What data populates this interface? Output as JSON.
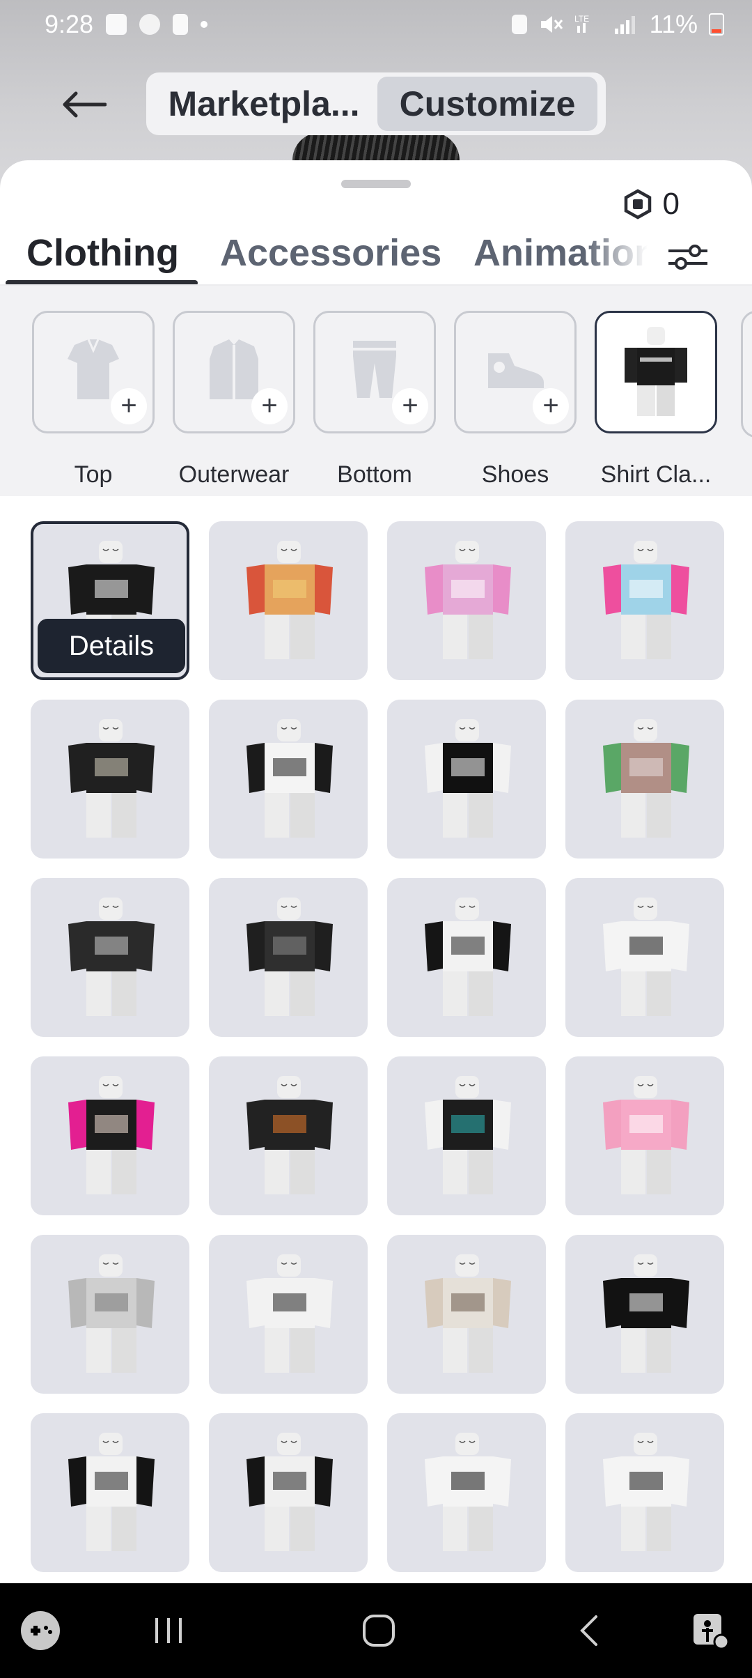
{
  "status_bar": {
    "time": "9:28",
    "battery": "11%"
  },
  "header": {
    "segments": [
      "Marketpla...",
      "Customize"
    ],
    "active_segment": "Customize"
  },
  "currency": {
    "amount": "0"
  },
  "tabs": [
    {
      "label": "Clothing",
      "active": true
    },
    {
      "label": "Accessories",
      "active": false
    },
    {
      "label": "Animation",
      "active": false
    }
  ],
  "slots": [
    {
      "label": "Top",
      "icon": "shirt-icon"
    },
    {
      "label": "Outerwear",
      "icon": "jacket-icon"
    },
    {
      "label": "Bottom",
      "icon": "pants-icon"
    },
    {
      "label": "Shoes",
      "icon": "shoe-icon"
    },
    {
      "label": "Shirt Cla...",
      "icon": "avatar-thumbnail"
    }
  ],
  "items": {
    "details_label": "Details",
    "list": [
      {
        "name": "black-shirt-selected",
        "torso": "#1a1a1a",
        "arms": "#1a1a1a",
        "accent": "#ffffff"
      },
      {
        "name": "red-yellow-shirt",
        "torso": "#e5a35c",
        "arms": "#d9553b",
        "accent": "#f2d27a"
      },
      {
        "name": "pink-purple-shirt",
        "torso": "#e5a9d6",
        "arms": "#e88dc8",
        "accent": "#ffffff"
      },
      {
        "name": "pink-anime-shirt",
        "torso": "#9fd3e8",
        "arms": "#ee4f9e",
        "accent": "#ffffff"
      },
      {
        "name": "skeleton-shirt",
        "torso": "#202020",
        "arms": "#202020",
        "accent": "#d7d2c0"
      },
      {
        "name": "maid-shirt",
        "torso": "#f4f4f4",
        "arms": "#1b1b1b",
        "accent": "#1b1b1b"
      },
      {
        "name": "ghost-shirt",
        "torso": "#111111",
        "arms": "#f2f2f2",
        "accent": "#ffffff"
      },
      {
        "name": "green-sleeve-shirt",
        "torso": "#b18f86",
        "arms": "#5aa766",
        "accent": "#e6dcdc"
      },
      {
        "name": "money-shirt",
        "torso": "#2a2a2a",
        "arms": "#2a2a2a",
        "accent": "#cccccc"
      },
      {
        "name": "black-vest-shirt",
        "torso": "#2f2f2f",
        "arms": "#1f1f1f",
        "accent": "#8a8a8a"
      },
      {
        "name": "raglan-shirt",
        "torso": "#f2f2f2",
        "arms": "#151515",
        "accent": "#222222"
      },
      {
        "name": "anime-face-shirt",
        "torso": "#f4f4f4",
        "arms": "#f4f4f4",
        "accent": "#111111"
      },
      {
        "name": "leopard-pink-shirt",
        "torso": "#1c1c1c",
        "arms": "#e31f91",
        "accent": "#f3e0d6"
      },
      {
        "name": "fire-graphic-shirt",
        "torso": "#222222",
        "arms": "#222222",
        "accent": "#e4792a"
      },
      {
        "name": "teal-shirt",
        "torso": "#1d1d1d",
        "arms": "#f2f2f2",
        "accent": "#2bb5b5"
      },
      {
        "name": "pink-kitty-shirt",
        "torso": "#f6a9c7",
        "arms": "#f3a0c0",
        "accent": "#ffffff"
      },
      {
        "name": "grey-distressed-shirt",
        "torso": "#cfcfcf",
        "arms": "#b8b8b8",
        "accent": "#777777"
      },
      {
        "name": "white-bow-shirt",
        "torso": "#f2f2f2",
        "arms": "#f2f2f2",
        "accent": "#222222"
      },
      {
        "name": "camo-shirt",
        "torso": "#e5e0d8",
        "arms": "#d7cbbd",
        "accent": "#6b5a4d"
      },
      {
        "name": "black-crop-shirt",
        "torso": "#121212",
        "arms": "#121212",
        "accent": "#ffffff"
      },
      {
        "name": "angel-shirt",
        "torso": "#f2f2f2",
        "arms": "#141414",
        "accent": "#222222"
      },
      {
        "name": "smiley-shirt",
        "torso": "#f0f0f0",
        "arms": "#151515",
        "accent": "#222222"
      },
      {
        "name": "bow-dress-shirt",
        "torso": "#f4f4f4",
        "arms": "#f4f4f4",
        "accent": "#111111"
      },
      {
        "name": "cross-stripe-shirt",
        "torso": "#f4f4f4",
        "arms": "#f4f4f4",
        "accent": "#151515"
      }
    ]
  }
}
